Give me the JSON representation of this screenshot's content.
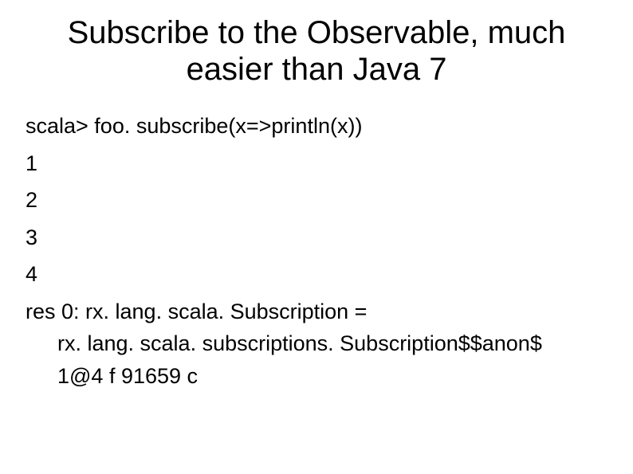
{
  "slide": {
    "title": "Subscribe to the Observable, much easier than Java 7",
    "code_prompt": "scala> foo. subscribe(x=>println(x))",
    "outputs": [
      "1",
      "2",
      "3",
      "4"
    ],
    "result_line1": "res 0: rx. lang. scala. Subscription =",
    "result_line2": "rx. lang. scala. subscriptions. Subscription$$anon$",
    "result_line3": "1@4 f 91659 c"
  }
}
